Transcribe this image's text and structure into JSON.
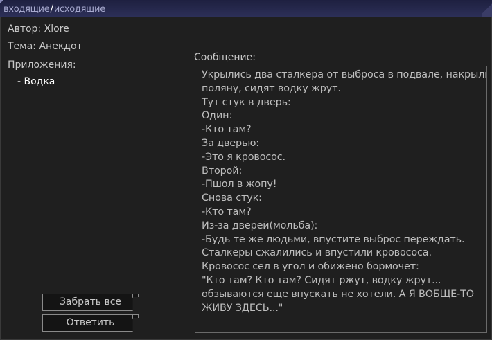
{
  "tabs": {
    "inbox": "входящие",
    "separator": "/",
    "outbox": "исходящие"
  },
  "header": {
    "author": "Автор: Xlore",
    "theme": "Тема: Анекдот",
    "attachments_label": "Приложения:",
    "attachments": [
      "- Водка"
    ]
  },
  "message": {
    "label": "Сообщение:",
    "lines": [
      "Укрылись два сталкера от выброса в подвале, накрыли",
      "поляну, сидят водку жрут.",
      "Тут стук в дверь:",
      "Один:",
      "-Кто там?",
      "За дверью:",
      "-Это я кровосос.",
      "Второй:",
      "-Пшол в жопу!",
      "Снова стук:",
      "-Кто там?",
      "Из-за дверей(мольба):",
      "-Будь те же людьми, впустите выброс переждать.",
      "Сталкеры сжалились и впустили кровососа.",
      "Кровосос сел в угол и обижено бормочет:",
      "\"Кто там? Кто там? Сидят ржут, водку жрут...",
      "обзываются еще впускать не хотели. А Я ВОБЩЕ-ТО",
      "ЖИВУ ЗДЕСЬ...\""
    ]
  },
  "buttons": {
    "take_all": "Забрать все",
    "reply": "Ответить"
  },
  "colors": {
    "background": "#1f1f1f",
    "tabbar": "#2c2f57",
    "tab_text": "#a8aacf",
    "text": "#bdbdbd"
  }
}
